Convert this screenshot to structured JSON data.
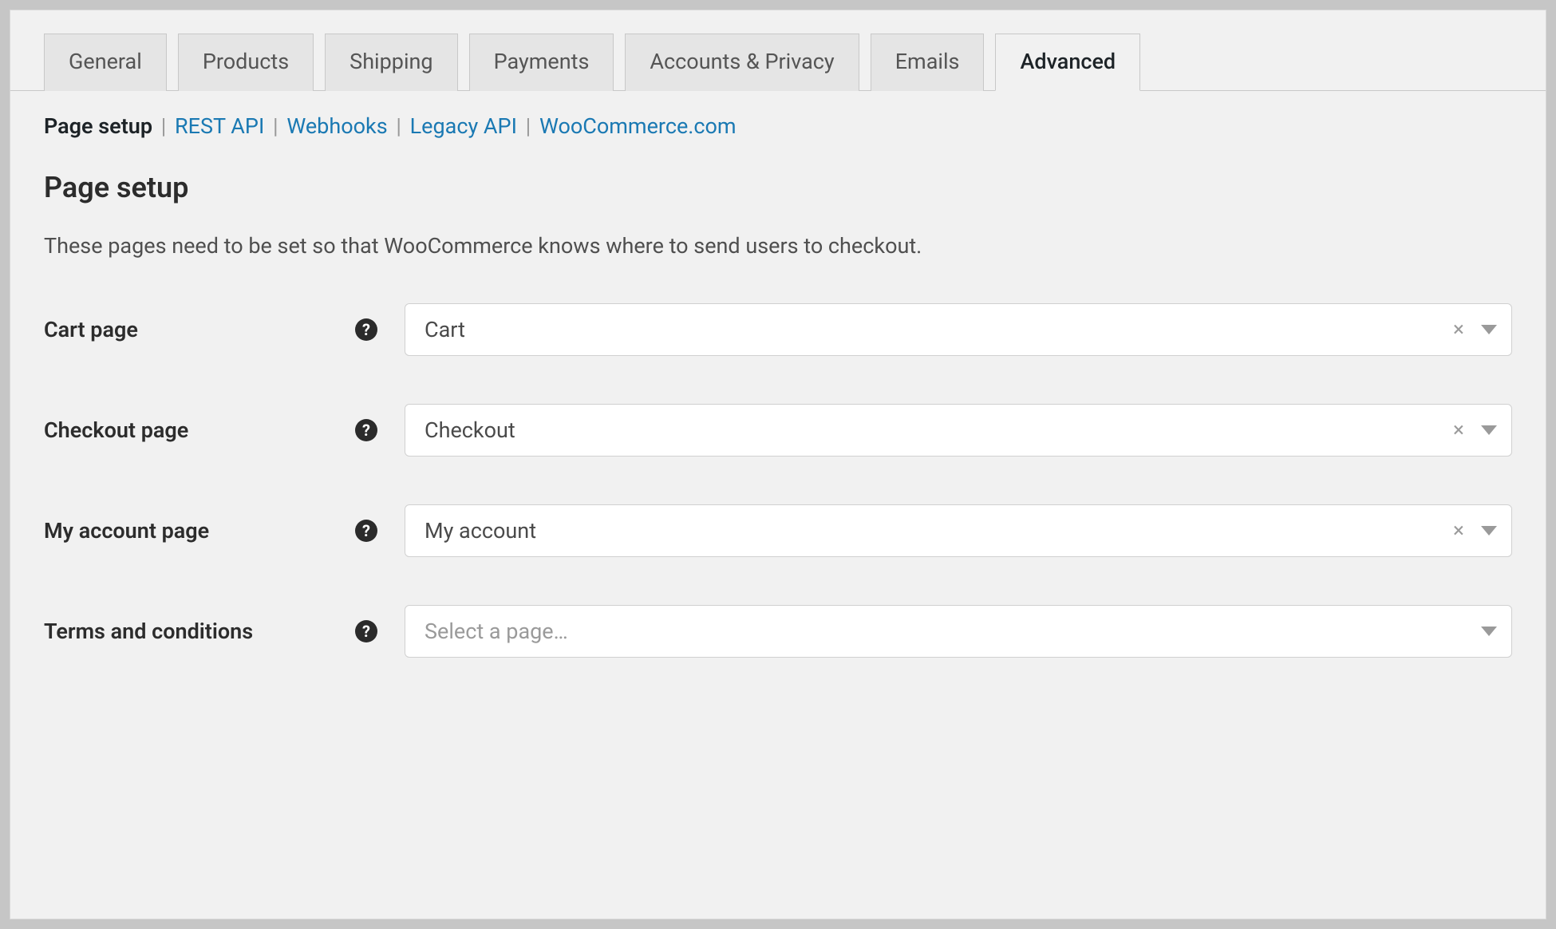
{
  "tabs": [
    {
      "label": "General",
      "active": false
    },
    {
      "label": "Products",
      "active": false
    },
    {
      "label": "Shipping",
      "active": false
    },
    {
      "label": "Payments",
      "active": false
    },
    {
      "label": "Accounts & Privacy",
      "active": false
    },
    {
      "label": "Emails",
      "active": false
    },
    {
      "label": "Advanced",
      "active": true
    }
  ],
  "subnav": {
    "current": "Page setup",
    "links": [
      "REST API",
      "Webhooks",
      "Legacy API",
      "WooCommerce.com"
    ]
  },
  "section": {
    "heading": "Page setup",
    "description": "These pages need to be set so that WooCommerce knows where to send users to checkout."
  },
  "fields": {
    "cart": {
      "label": "Cart page",
      "value": "Cart",
      "clearable": true
    },
    "checkout": {
      "label": "Checkout page",
      "value": "Checkout",
      "clearable": true
    },
    "account": {
      "label": "My account page",
      "value": "My account",
      "clearable": true
    },
    "terms": {
      "label": "Terms and conditions",
      "value": "",
      "placeholder": "Select a page…",
      "clearable": false
    }
  }
}
